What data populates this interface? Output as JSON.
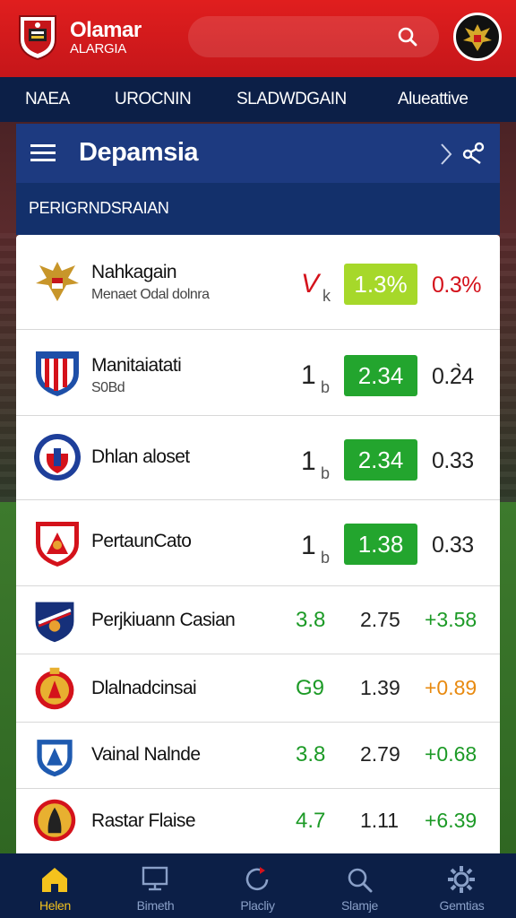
{
  "header": {
    "title": "Olamar",
    "subtitle": "ALARGIA"
  },
  "nav": {
    "items": [
      "NAEA",
      "UROCNIN",
      "SLADWDGAIN",
      "Alueattive"
    ]
  },
  "panel": {
    "title": "Depamsia",
    "subheader": "PERIGRNDSRAIAN"
  },
  "teams": [
    {
      "name": "Nahkagain",
      "sub": "Menaet Odal dolnra",
      "num": "V",
      "b": "k",
      "odds": "1.3%",
      "right": "0.3%",
      "odds_color": "#a6d82a",
      "right_color": "#d4121b",
      "num_color": "#d4121b"
    },
    {
      "name": "Manitaiatati",
      "sub": "S0Bd",
      "num": "1",
      "b": "b",
      "odds": "2.34",
      "right": "0.2̀ ",
      "odds_color": "#23a52e",
      "right_color": "#222"
    },
    {
      "name": "Dhlan aloset",
      "sub": "",
      "num": "1",
      "b": "b",
      "odds": "2.34",
      "right": "0.33",
      "odds_color": "#23a52e",
      "right_color": "#222"
    },
    {
      "name": "PertaunCato",
      "sub": "",
      "num": "1",
      "b": "b",
      "odds": "1.38",
      "right": "0.33",
      "odds_color": "#23a52e",
      "right_color": "#222"
    },
    {
      "name": "Perjkiuann Casian",
      "c1": "3.8",
      "c2": "2.75",
      "c3": "+3.58",
      "c3_color": "#1c9a26"
    },
    {
      "name": "Dlalnadcinsai",
      "c1": "G9",
      "c2": "1.39",
      "c3": "+0.89",
      "c3_color": "#e88a10"
    },
    {
      "name": "Vainal Nalnde",
      "c1": "3.8",
      "c2": "2.79",
      "c3": "+0.68",
      "c3_color": "#1c9a26"
    },
    {
      "name": "Rastar Flaise",
      "c1": "4.7",
      "c2": "1.11",
      "c3": "+6.39",
      "c3_color": "#1c9a26"
    }
  ],
  "bottom_nav": [
    {
      "label": "Helen",
      "icon": "home-icon",
      "active": true
    },
    {
      "label": "Bimeth",
      "icon": "monitor-icon",
      "active": false
    },
    {
      "label": "Placliy",
      "icon": "refresh-icon",
      "active": false
    },
    {
      "label": "Slamje",
      "icon": "search-icon",
      "active": false
    },
    {
      "label": "Gemtias",
      "icon": "gear-icon",
      "active": false
    }
  ],
  "colors": {
    "header_red": "#d41a1c",
    "nav_navy": "#0c1f47",
    "panel_blue": "#1d3a80",
    "odds_green": "#23a52e",
    "odds_lime": "#a6d82a",
    "active_yellow": "#f4c21d"
  }
}
